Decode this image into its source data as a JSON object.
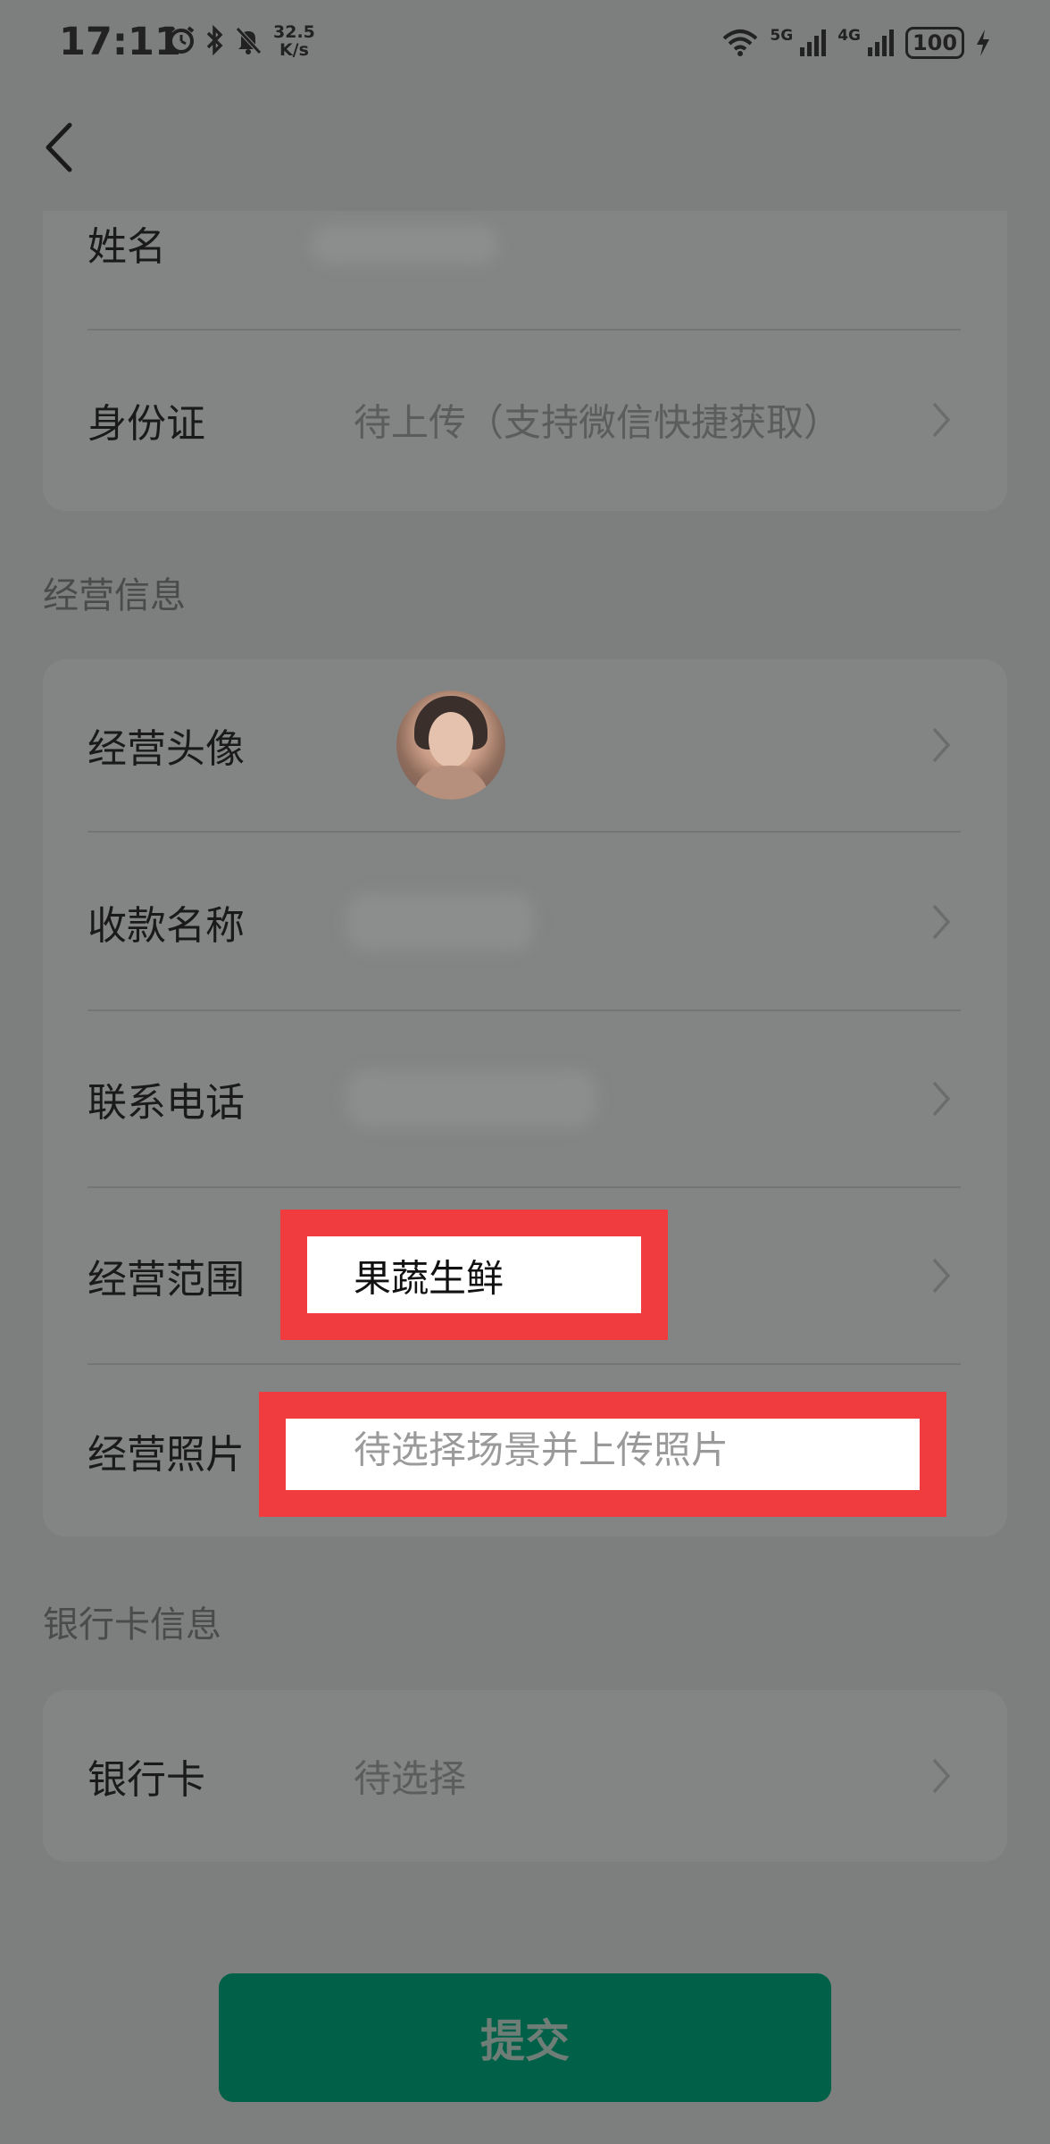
{
  "status_bar": {
    "time": "17:11",
    "net_speed_value": "32.5",
    "net_speed_unit": "K/s",
    "signal_1_label": "5G",
    "signal_2_label": "4G",
    "battery": "100",
    "icons": [
      "alarm-icon",
      "bluetooth-icon",
      "mute-icon",
      "wifi-icon",
      "signal-icon",
      "signal-icon",
      "battery-icon",
      "charging-icon"
    ]
  },
  "nav": {
    "back_icon": "chevron-left-icon"
  },
  "identity": {
    "name_label": "姓名",
    "id_label": "身份证",
    "id_value": "待上传（支持微信快捷获取）"
  },
  "business": {
    "section_title": "经营信息",
    "avatar_label": "经营头像",
    "payee_name_label": "收款名称",
    "phone_label": "联系电话",
    "scope_label": "经营范围",
    "scope_value": "果蔬生鲜",
    "photo_label": "经营照片",
    "photo_value": "待选择场景并上传照片"
  },
  "bank": {
    "section_title": "银行卡信息",
    "card_label": "银行卡",
    "card_value": "待选择"
  },
  "submit_label": "提交",
  "colors": {
    "overlay_bg": "#7d7f7e",
    "card_bg": "#838584",
    "submit_bg": "#006048",
    "highlight_red": "#f03c3f"
  }
}
